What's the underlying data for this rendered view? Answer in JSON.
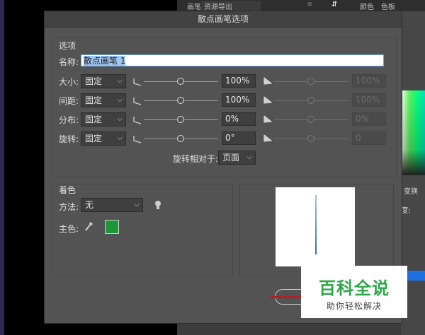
{
  "background": {
    "topbar_left": "画笔",
    "topbar_mid": "资源导出",
    "topbar_right": "颜色",
    "topbar_right2": "色板",
    "right_label_transform": "变换",
    "right_label_colon": "度:"
  },
  "dialog": {
    "title": "散点画笔选项",
    "options_section": "选项",
    "name_label": "名称:",
    "name_value": "散点画笔 1",
    "rows": [
      {
        "label": "大小:",
        "mode": "固定",
        "value": "100%",
        "value2": "100%"
      },
      {
        "label": "间距:",
        "mode": "固定",
        "value": "100%",
        "value2": "100%"
      },
      {
        "label": "分布:",
        "mode": "固定",
        "value": "0%",
        "value2": "0%"
      },
      {
        "label": "旋转:",
        "mode": "固定",
        "value": "0°",
        "value2": "0"
      }
    ],
    "rotation_relative_label": "旋转相对于:",
    "rotation_relative_value": "页面",
    "coloring_section": "着色",
    "method_label": "方法:",
    "method_value": "无",
    "key_color_label": "主色:",
    "key_color": "#1f9638"
  },
  "watermark": {
    "title": "百科全说",
    "subtitle": "助你轻松解决"
  }
}
